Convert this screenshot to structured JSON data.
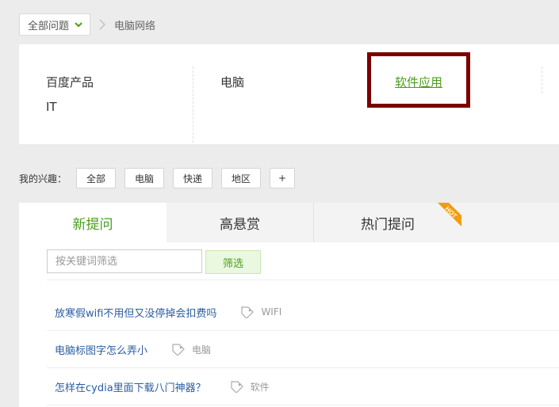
{
  "breadcrumb": {
    "dropdown_label": "全部问题",
    "current": "电脑网络"
  },
  "categories": {
    "col1": [
      "百度产品",
      "IT"
    ],
    "col2": [
      "电脑"
    ],
    "col3_active": "软件应用"
  },
  "interests": {
    "label": "我的兴趣：",
    "tags": [
      "全部",
      "电脑",
      "快递",
      "地区",
      "+"
    ]
  },
  "tabs": {
    "items": [
      "新提问",
      "高悬赏",
      "热门提问"
    ],
    "active": "新提问",
    "hot_badge": "HOT"
  },
  "filter": {
    "placeholder": "按关键词筛选",
    "button": "筛选"
  },
  "questions": [
    {
      "title": "放寒假wifi不用但又没停掉会扣费吗",
      "tag": "WIFI"
    },
    {
      "title": "电脑标图字怎么弄小",
      "tag": "电脑"
    },
    {
      "title": "怎样在cydia里面下载八门神器？",
      "tag": "软件"
    }
  ],
  "colors": {
    "accent_green": "#4a9e1b",
    "link_blue": "#2a5d9f",
    "highlight_border": "#7b0000",
    "hot_orange": "#f39c12"
  }
}
